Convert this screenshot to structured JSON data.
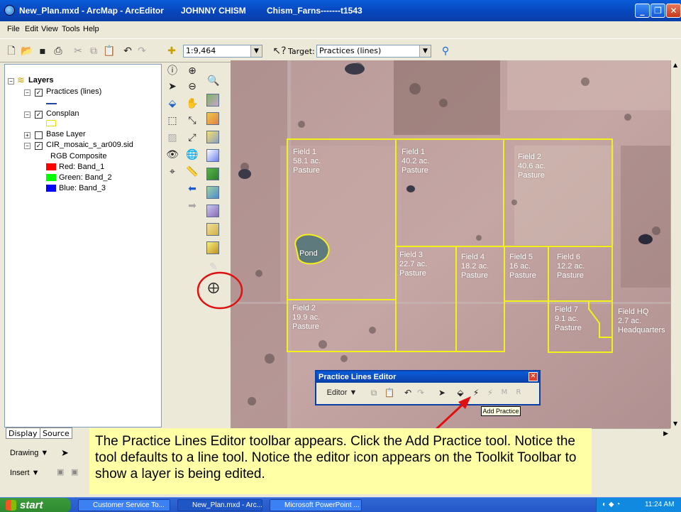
{
  "window": {
    "title": "New_Plan.mxd - ArcMap - ArcEditor",
    "user": "JOHNNY CHISM",
    "farm": "Chism_Farns-------t1543"
  },
  "menu": [
    "File",
    "Edit",
    "View",
    "Tools",
    "Help"
  ],
  "toolbar": {
    "scale": "1:9,464",
    "target_label": "Target:",
    "target_value": "Practices (lines)"
  },
  "toc": {
    "root": "Layers",
    "layers": [
      {
        "name": "Practices (lines)",
        "checked": true
      },
      {
        "name": "Consplan",
        "checked": true
      },
      {
        "name": "Base Layer",
        "checked": false
      },
      {
        "name": "CIR_mosaic_s_ar009.sid",
        "checked": true
      }
    ],
    "rgb_title": "RGB Composite",
    "bands": [
      {
        "label": "Red:   Band_1",
        "color": "#ff0000"
      },
      {
        "label": "Green: Band_2",
        "color": "#00ff00"
      },
      {
        "label": "Blue:  Band_3",
        "color": "#0000ff"
      }
    ],
    "tabs": [
      "Display",
      "Source"
    ]
  },
  "drawing": {
    "drawing_label": "Drawing ▼",
    "insert_label": "Insert ▼"
  },
  "map": {
    "fields": [
      {
        "text": "Field 1\n58.1 ac.\nPasture"
      },
      {
        "text": "Field 1\n40.2 ac.\nPasture"
      },
      {
        "text": "Field 2\n40.6 ac.\nPasture"
      },
      {
        "text": "Pond"
      },
      {
        "text": "Field 3\n22.7 ac.\nPasture"
      },
      {
        "text": "Field 4\n18.2 ac.\nPasture"
      },
      {
        "text": "Field 5\n16 ac.\nPasture"
      },
      {
        "text": "Field 6\n12.2 ac.\nPasture"
      },
      {
        "text": "Field 2\n19.9 ac.\nPasture"
      },
      {
        "text": "Field 7\n9.1 ac.\nPasture"
      },
      {
        "text": "Field HQ\n2.7 ac.\nHeadquarters"
      }
    ]
  },
  "editor": {
    "title": "Practice Lines Editor",
    "menu_label": "Editor ▼",
    "tooltip": "Add Practice",
    "m_label": "M",
    "r_label": "R"
  },
  "note": {
    "text": "The Practice Lines Editor toolbar appears. Click the Add Practice tool. Notice the tool defaults to a line tool. Notice the editor icon appears on the Toolkit Toolbar to show a layer is being edited."
  },
  "taskbar": {
    "start": "start",
    "tasks": [
      "Customer Service To...",
      "New_Plan.mxd - Arc...",
      "Microsoft PowerPoint ..."
    ],
    "clock": "11:24 AM"
  },
  "colors": {
    "field_boundary": "#f3f01a",
    "annotation_circle": "#e01010",
    "arrow": "#e01010"
  }
}
